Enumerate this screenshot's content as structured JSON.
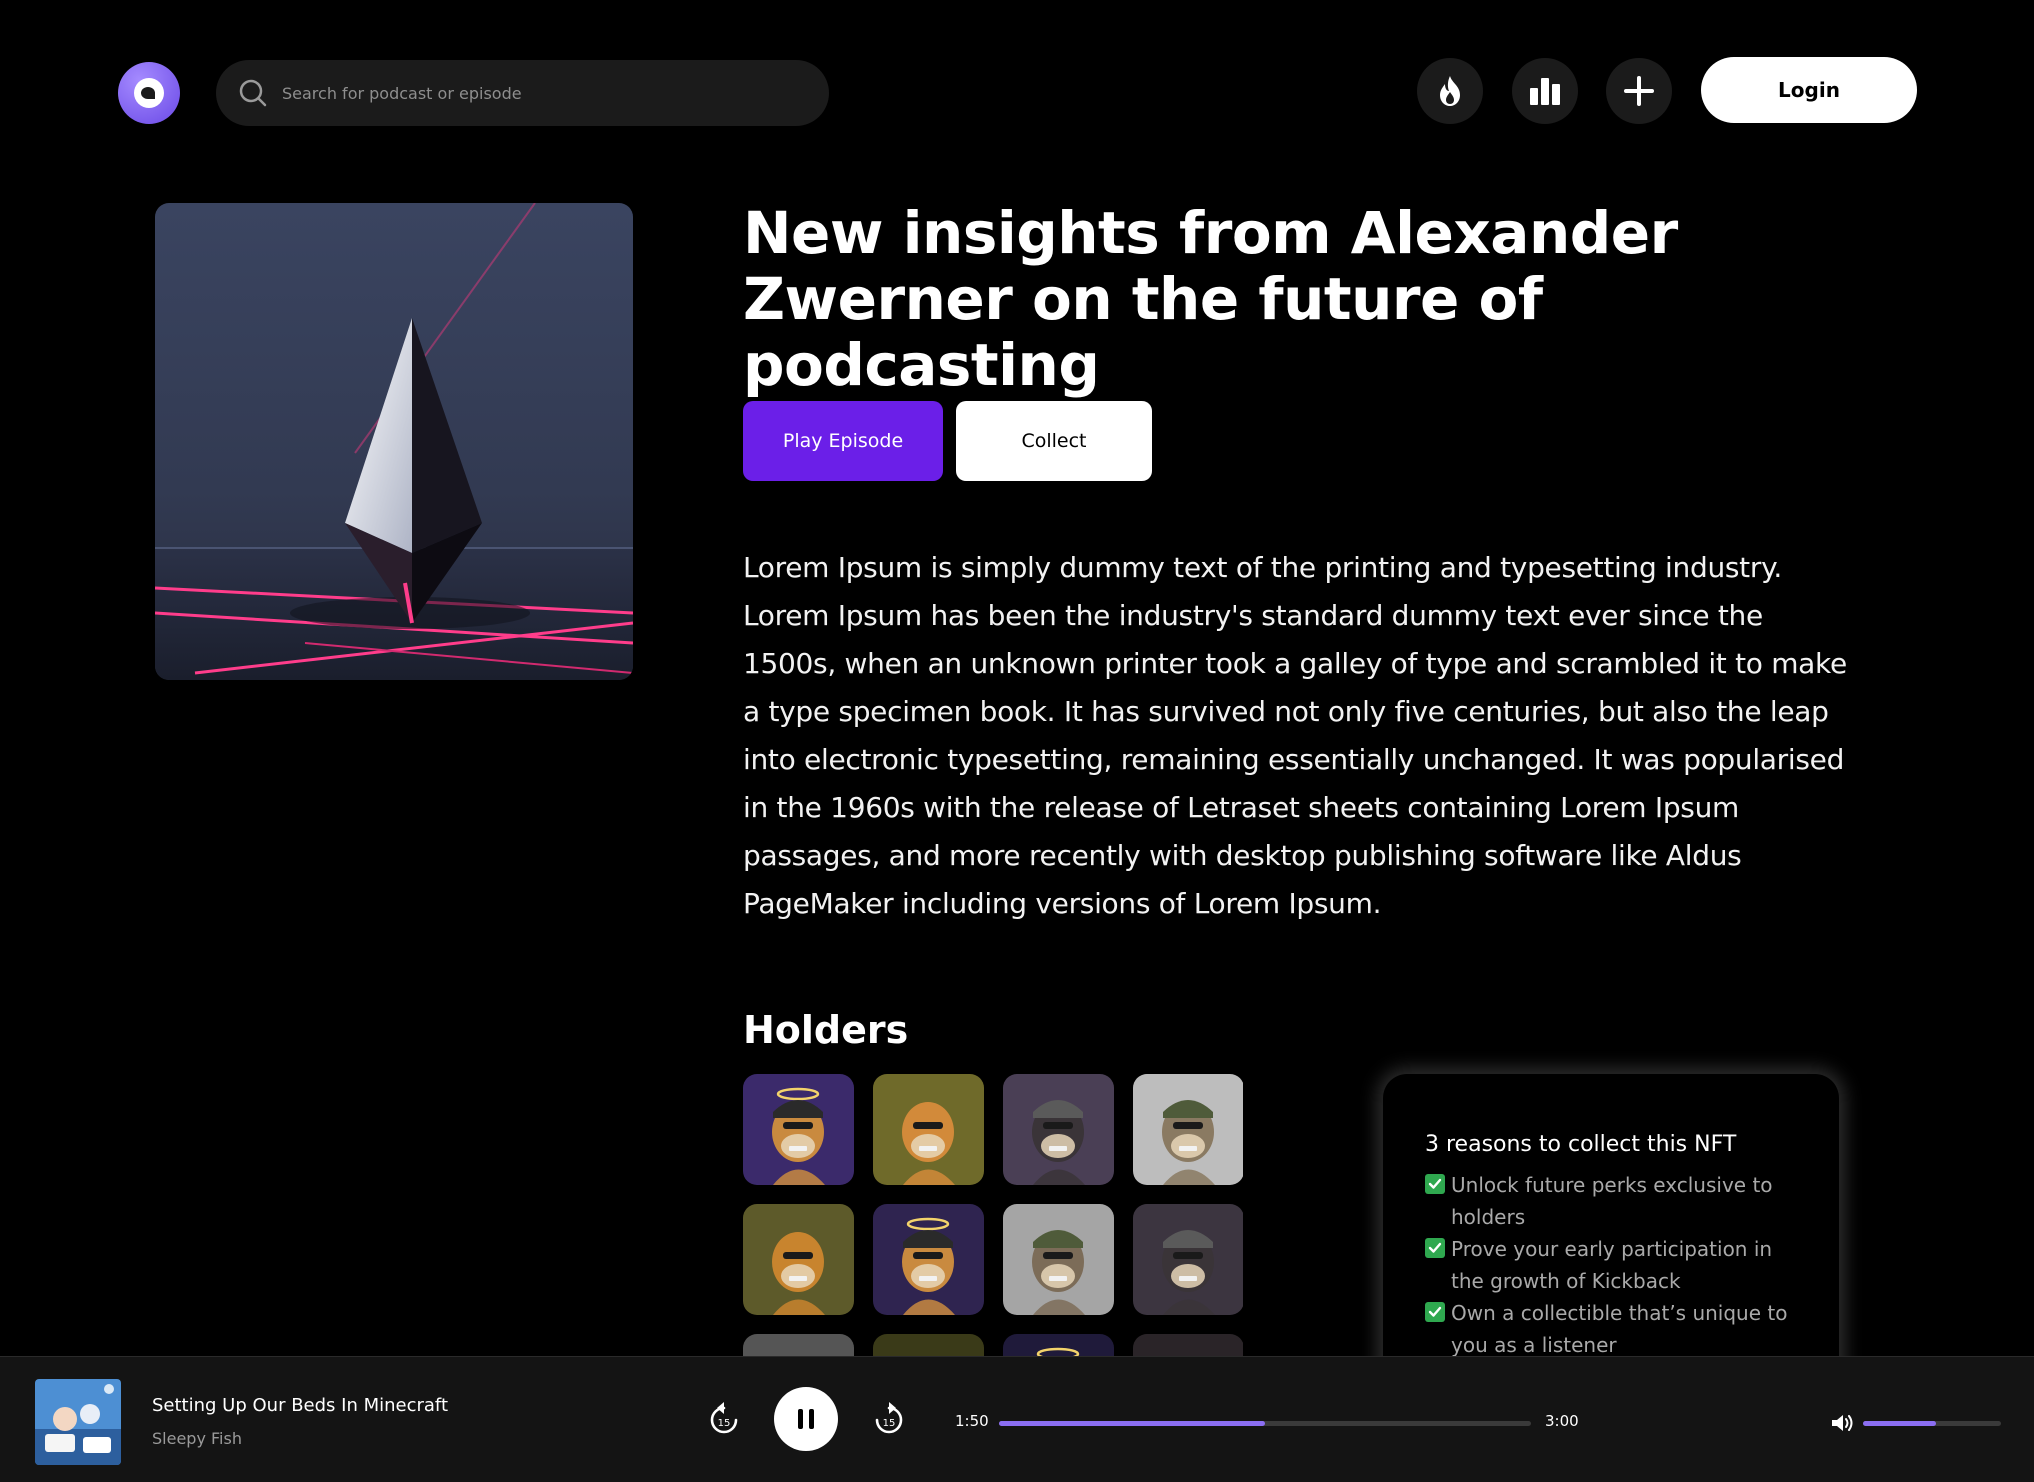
{
  "header": {
    "search_placeholder": "Search for podcast or episode",
    "icons": [
      "fire-icon",
      "chart-icon",
      "plus-icon"
    ],
    "login_label": "Login"
  },
  "episode": {
    "title": "New insights from Alexander Zwerner on the future of podcasting",
    "play_label": "Play Episode",
    "collect_label": "Collect",
    "description": "Lorem Ipsum is simply dummy text of the printing and typesetting industry. Lorem Ipsum has been the industry's standard dummy text ever since the 1500s, when an unknown printer took a galley of type and scrambled it to make a type specimen book. It has survived not only five centuries, but also the leap into electronic typesetting, remaining essentially unchanged. It was popularised in the 1960s with the release of Letraset sheets containing Lorem Ipsum passages, and more recently with desktop publishing software like Aldus PageMaker including versions of Lorem Ipsum."
  },
  "holders": {
    "title": "Holders"
  },
  "nft_card": {
    "title": "3 reasons to collect this NFT",
    "reasons": [
      "Unlock future perks exclusive to holders",
      "Prove your early participation in the growth of Kickback",
      "Own a collectible that’s unique to you as a listener"
    ]
  },
  "player": {
    "track_title": "Setting Up Our Beds In Minecraft",
    "artist": "Sleepy Fish",
    "elapsed": "1:50",
    "duration": "3:00",
    "progress_fraction": 0.5,
    "volume_fraction": 0.53,
    "skip_seconds": "15"
  },
  "colors": {
    "accent": "#6b1fe8",
    "progress": "#8b6ef2",
    "background": "#000000",
    "surface": "#1b1b1b"
  }
}
